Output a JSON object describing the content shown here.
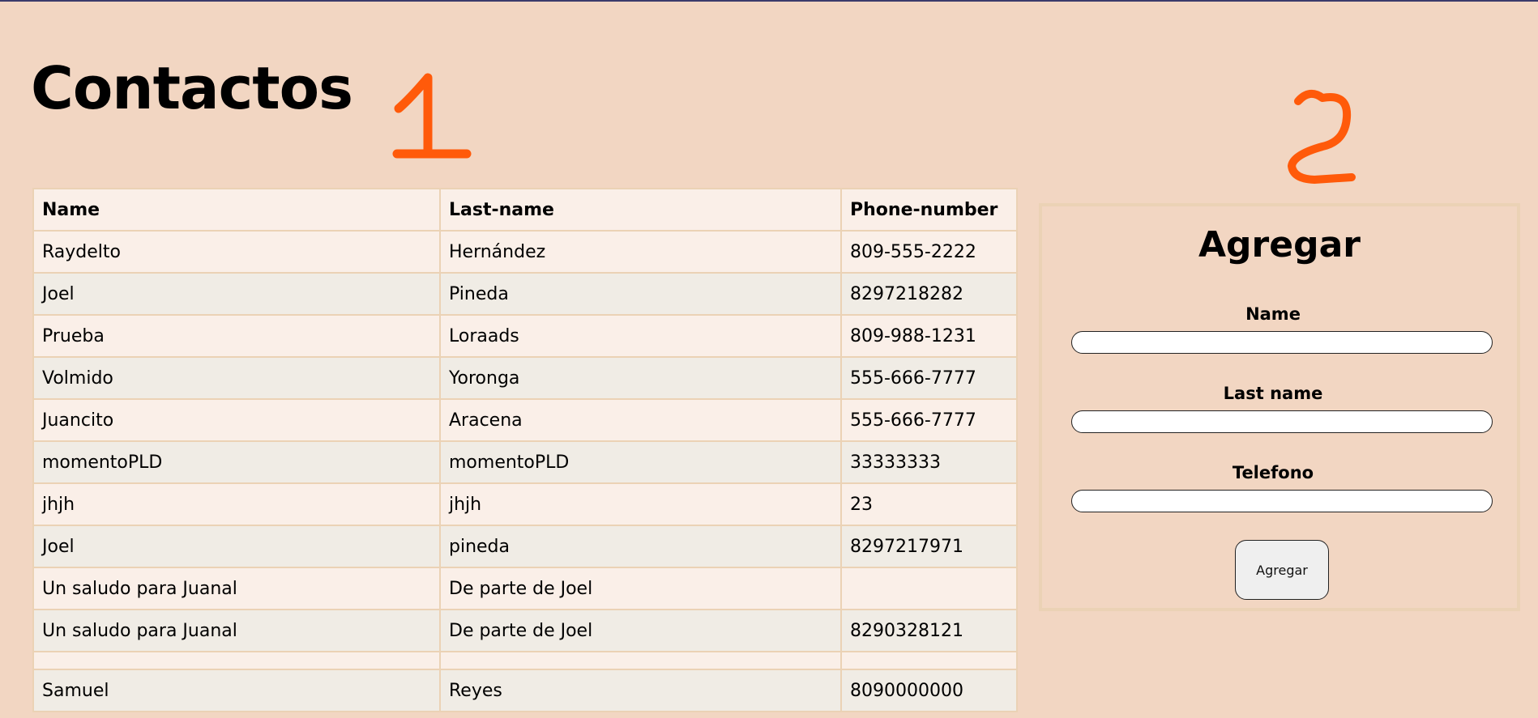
{
  "page": {
    "title": "Contactos"
  },
  "annotations": {
    "first": "1",
    "second": "2",
    "color": "#ff5a0a"
  },
  "table": {
    "headers": [
      "Name",
      "Last-name",
      "Phone-number"
    ],
    "rows": [
      [
        "Raydelto",
        "Hernández",
        "809-555-2222"
      ],
      [
        "Joel",
        "Pineda",
        "8297218282"
      ],
      [
        "Prueba",
        "Loraads",
        "809-988-1231"
      ],
      [
        "Volmido",
        "Yoronga",
        "555-666-7777"
      ],
      [
        "Juancito",
        "Aracena",
        "555-666-7777"
      ],
      [
        "momentoPLD",
        "momentoPLD",
        "33333333"
      ],
      [
        "jhjh",
        "jhjh",
        "23"
      ],
      [
        "Joel",
        "pineda",
        "8297217971"
      ],
      [
        "Un saludo para Juanal",
        "De parte de Joel",
        ""
      ],
      [
        "Un saludo para Juanal",
        "De parte de Joel",
        "8290328121"
      ],
      [
        "",
        "",
        ""
      ],
      [
        "Samuel",
        "Reyes",
        "8090000000"
      ]
    ]
  },
  "form": {
    "title": "Agregar",
    "fields": [
      {
        "label": "Name",
        "value": ""
      },
      {
        "label": "Last name",
        "value": ""
      },
      {
        "label": "Telefono",
        "value": ""
      }
    ],
    "submit_label": "Agregar"
  }
}
